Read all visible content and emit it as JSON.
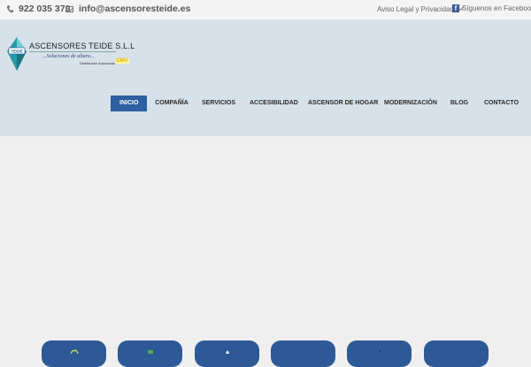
{
  "topbar": {
    "phone": "922 035 370",
    "email": "info@ascensoresteide.es",
    "legal_link": "Aviso Legal y Privacidad",
    "facebook_link": "Síguenos en Facebook"
  },
  "logo": {
    "title": "ASCENSORES TEIDE S.L.L",
    "emblem_text": "TEIDE",
    "tagline": "...Soluciones de altura...",
    "distributor": "Distribuidor Autorizado",
    "partner": "GMV"
  },
  "nav": {
    "items": [
      {
        "label": "INICIO"
      },
      {
        "label": "COMPAÑÍA"
      },
      {
        "label": "SERVICIOS"
      },
      {
        "label": "ACCESIBILIDAD"
      },
      {
        "label": "ASCENSOR DE HOGAR"
      },
      {
        "label": "MODERNIZACIÓN"
      },
      {
        "label": "BLOG"
      },
      {
        "label": "CONTACTO"
      }
    ],
    "active_index": 0
  },
  "colors": {
    "accent": "#2d5fa1",
    "header_bg": "#d6e1ea",
    "page_bg": "#efefef",
    "tile_bg": "#2d5a96"
  },
  "icons": [
    "phone-icon",
    "mail-icon",
    "chevron-down-icon",
    "facebook-icon"
  ]
}
